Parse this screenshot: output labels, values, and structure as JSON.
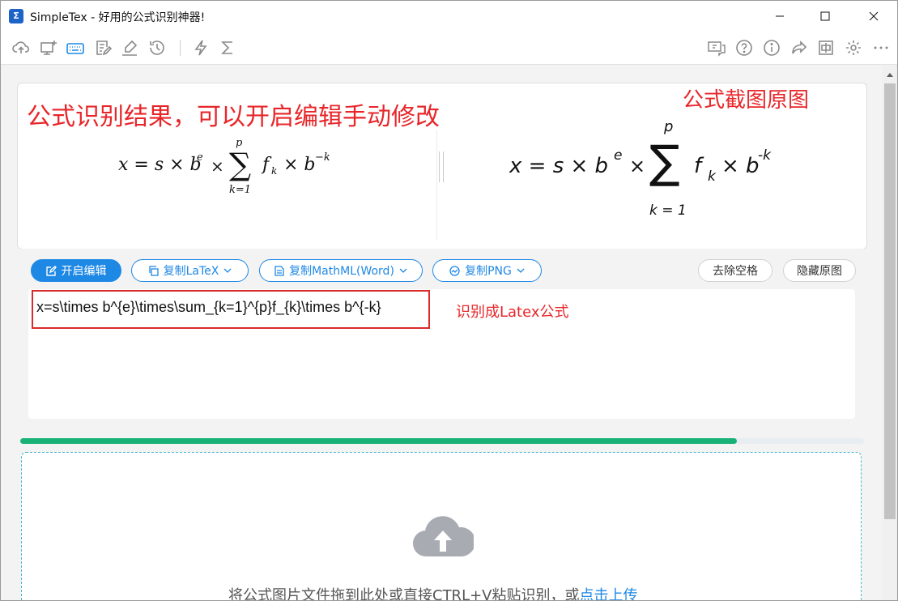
{
  "window": {
    "title": "SimpleTex - 好用的公式识别神器!",
    "app_icon_glyph": "Σ",
    "controls": [
      "minimize",
      "maximize",
      "close"
    ]
  },
  "toolbar": {
    "left_icons": [
      "cloud-upload-icon",
      "screen-add-icon",
      "keyboard-icon",
      "document-edit-icon",
      "handwrite-icon",
      "history-icon",
      "lightning-icon",
      "sigma-icon"
    ],
    "right_icons": [
      "feedback-icon",
      "help-icon",
      "info-icon",
      "share-icon",
      "pin-window-icon",
      "settings-icon",
      "more-icon"
    ],
    "active_icon": "keyboard-icon",
    "icon_color": "#8a8a8a",
    "active_color": "#1e88e5"
  },
  "annotations": {
    "left": "公式识别结果，可以开启编辑手动修改",
    "right": "公式截图原图",
    "latex": "识别成Latex公式",
    "color": "#e8262a"
  },
  "rendered_formula": {
    "lhs": "x = s × b",
    "exp_e": "e",
    "times": "×",
    "sum": "∑",
    "upper": "p",
    "lower": "k=1",
    "f": "f",
    "sub_k": "k",
    "tail": "× b",
    "exp_neg_k": "−k"
  },
  "original_formula": {
    "lhs": "x =  s × b",
    "exp_e": "e",
    "times": "×",
    "sum": "∑",
    "upper": "p",
    "lower": "k = 1",
    "f": "f",
    "sub_k": "k",
    "tail": "× b",
    "exp_neg_k": "-k"
  },
  "buttons": {
    "edit": "开启编辑",
    "copy_latex": "复制LaTeX",
    "copy_mathml": "复制MathML(Word)",
    "copy_png": "复制PNG",
    "remove_spaces": "去除空格",
    "hide_original": "隐藏原图"
  },
  "latex": {
    "value": "x=s\\times b^{e}\\times\\sum_{k=1}^{p}f_{k}\\times b^{-k}"
  },
  "progress": {
    "fraction": 0.849,
    "color": "#18b277"
  },
  "dropzone": {
    "text": "将公式图片文件拖到此处或直接CTRL+V粘贴识别，或",
    "link": "点击上传",
    "icon": "cloud-upload-icon"
  }
}
